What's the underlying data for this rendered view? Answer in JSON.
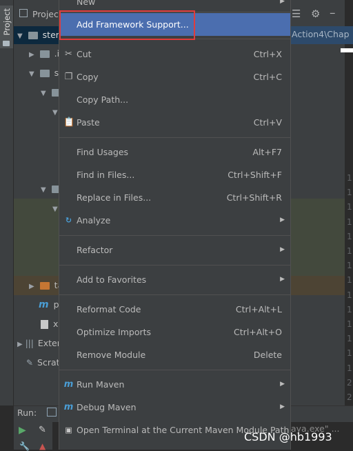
{
  "toolstrip": {
    "project_tab": "Project"
  },
  "project_panel": {
    "title": "Projec",
    "tree": [
      {
        "text": "stere",
        "indent": 0
      },
      {
        "text": ".id",
        "indent": 1
      },
      {
        "text": "sr",
        "indent": 1
      },
      {
        "text": "ta",
        "indent": 1
      },
      {
        "text": "po",
        "indent": 1
      },
      {
        "text": "xn",
        "indent": 1
      },
      {
        "text": "Exter",
        "indent": 0
      },
      {
        "text": "Scrat",
        "indent": 0
      }
    ]
  },
  "editor": {
    "path": "Action4\\Chap",
    "line_numbers": [
      "1",
      "1",
      "1",
      "1",
      "1",
      "1",
      "1",
      "1",
      "1",
      "1",
      "1",
      "1",
      "1",
      "1",
      "2",
      "2",
      "2"
    ]
  },
  "run_bar": {
    "label": "Run:",
    "console_snippet": "aya.exe\" ..."
  },
  "watermark": "CSDN @hb1993",
  "context_menu": {
    "items": [
      {
        "label": "New",
        "shortcut": "",
        "submenu": true,
        "icon": ""
      },
      {
        "label": "Add Framework Support...",
        "shortcut": "",
        "submenu": false,
        "icon": "",
        "highlighted": true
      },
      {
        "label": "Cut",
        "shortcut": "Ctrl+X",
        "submenu": false,
        "icon": "scissors-icon"
      },
      {
        "label": "Copy",
        "shortcut": "Ctrl+C",
        "submenu": false,
        "icon": "copy-icon"
      },
      {
        "label": "Copy Path...",
        "shortcut": "",
        "submenu": false,
        "icon": ""
      },
      {
        "label": "Paste",
        "shortcut": "Ctrl+V",
        "submenu": false,
        "icon": "paste-icon"
      },
      {
        "label": "Find Usages",
        "shortcut": "Alt+F7",
        "submenu": false,
        "icon": ""
      },
      {
        "label": "Find in Files...",
        "shortcut": "Ctrl+Shift+F",
        "submenu": false,
        "icon": ""
      },
      {
        "label": "Replace in Files...",
        "shortcut": "Ctrl+Shift+R",
        "submenu": false,
        "icon": ""
      },
      {
        "label": "Analyze",
        "shortcut": "",
        "submenu": true,
        "icon": "analyze-icon"
      },
      {
        "label": "Refactor",
        "shortcut": "",
        "submenu": true,
        "icon": ""
      },
      {
        "label": "Add to Favorites",
        "shortcut": "",
        "submenu": true,
        "icon": ""
      },
      {
        "label": "Reformat Code",
        "shortcut": "Ctrl+Alt+L",
        "submenu": false,
        "icon": ""
      },
      {
        "label": "Optimize Imports",
        "shortcut": "Ctrl+Alt+O",
        "submenu": false,
        "icon": ""
      },
      {
        "label": "Remove Module",
        "shortcut": "Delete",
        "submenu": false,
        "icon": ""
      },
      {
        "label": "Run Maven",
        "shortcut": "",
        "submenu": true,
        "icon": "maven-icon"
      },
      {
        "label": "Debug Maven",
        "shortcut": "",
        "submenu": true,
        "icon": "maven-debug-icon"
      },
      {
        "label": "Open Terminal at the Current Maven Module Path",
        "shortcut": "",
        "submenu": false,
        "icon": "maven-terminal-icon"
      }
    ]
  },
  "colors": {
    "highlight": "#4b6eaf",
    "annotation_box": "#e03c3c",
    "menu_bg": "#3c3f41"
  }
}
